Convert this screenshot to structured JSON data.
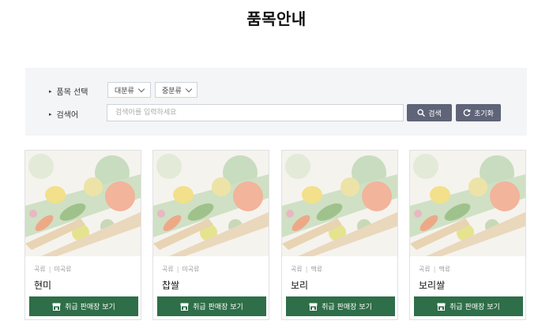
{
  "page": {
    "title": "품목안내"
  },
  "filter": {
    "item_select_label": "품목 선택",
    "major_category": "대분류",
    "middle_category": "중분류",
    "keyword_label": "검색어",
    "search_placeholder": "검색어를 입력하세요",
    "search_button": "검색",
    "reset_button": "초기화"
  },
  "cards": [
    {
      "category": "곡류",
      "subcategory": "미곡류",
      "name": "현미",
      "button": "취급 판매장 보기"
    },
    {
      "category": "곡류",
      "subcategory": "미곡류",
      "name": "찹쌀",
      "button": "취급 판매장 보기"
    },
    {
      "category": "곡류",
      "subcategory": "맥류",
      "name": "보리",
      "button": "취급 판매장 보기"
    },
    {
      "category": "곡류",
      "subcategory": "맥류",
      "name": "보리쌀",
      "button": "취급 판매장 보기"
    }
  ],
  "colors": {
    "button_green": "#2e6e48",
    "button_gray": "#5f6478",
    "panel_bg": "#f4f5f7"
  },
  "icons": {
    "search": "search-icon",
    "reset": "refresh-icon",
    "store": "store-icon"
  }
}
